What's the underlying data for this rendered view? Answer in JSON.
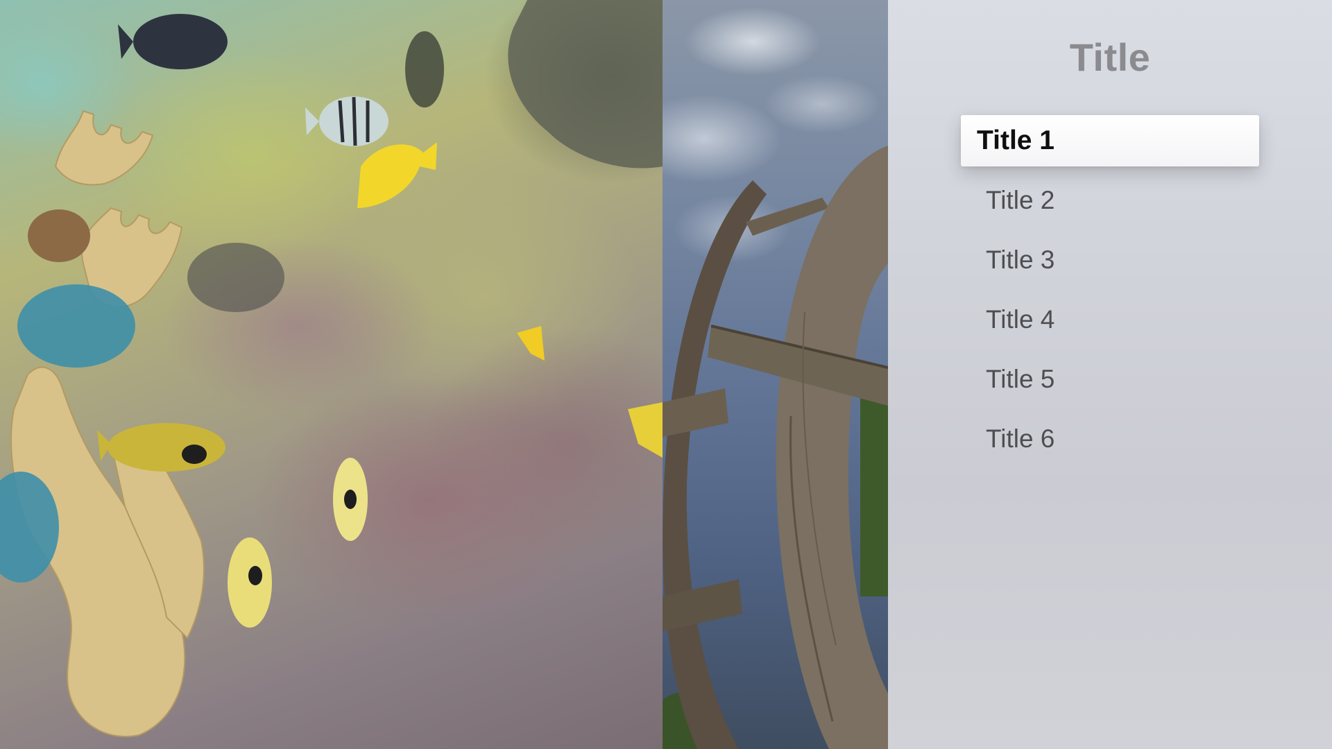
{
  "menu": {
    "title": "Title",
    "items": [
      {
        "label": "Title 1",
        "focused": true
      },
      {
        "label": "Title 2",
        "focused": false
      },
      {
        "label": "Title 3",
        "focused": false
      },
      {
        "label": "Title 4",
        "focused": false
      },
      {
        "label": "Title 5",
        "focused": false
      },
      {
        "label": "Title 6",
        "focused": false
      }
    ]
  },
  "colors": {
    "panel_background": "#d1d3da",
    "title_text": "#8b8b8f",
    "item_text": "#4e4e52",
    "focused_background": "#ffffff",
    "focused_text": "#0f0f10"
  }
}
